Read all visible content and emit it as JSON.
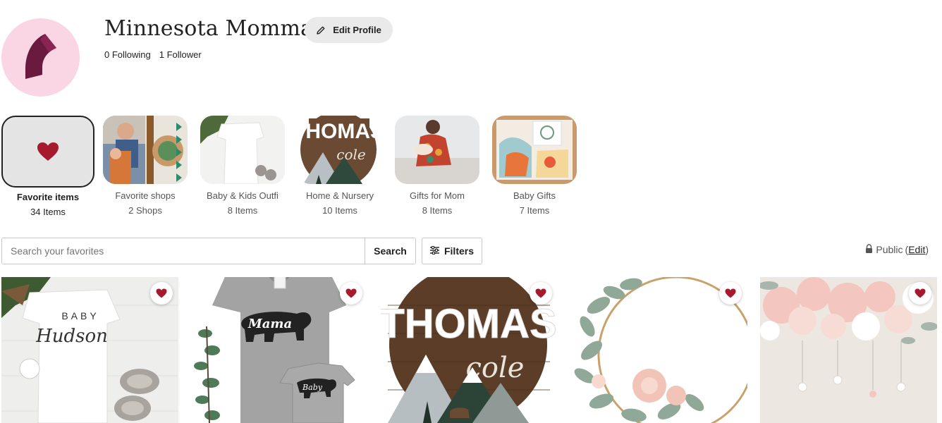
{
  "profile": {
    "name": "Minnesota Momma",
    "edit_label": "Edit Profile",
    "following": "0 Following",
    "followers": "1 Follower",
    "avatar_bg": "#fad5e3",
    "avatar_mark": "#6b1a3f"
  },
  "collections": [
    {
      "title": "Favorite items",
      "count": "34 Items",
      "active": true,
      "icon": "heart-icon"
    },
    {
      "title": "Favorite shops",
      "count": "2 Shops"
    },
    {
      "title": "Baby & Kids Outfi",
      "count": "8 Items"
    },
    {
      "title": "Home & Nursery",
      "count": "10 Items"
    },
    {
      "title": "Gifts for Mom",
      "count": "8 Items"
    },
    {
      "title": "Baby Gifts",
      "count": "7 Items"
    }
  ],
  "search": {
    "placeholder": "Search your favorites",
    "button_label": "Search",
    "filters_label": "Filters"
  },
  "visibility": {
    "status": "Public",
    "open_paren": "(",
    "edit_label": "Edit",
    "close_paren": ")"
  },
  "thumbnail_text": {
    "baby_onesie_top": "BABY",
    "baby_onesie_name": "Hudson",
    "nursery_sign_top": "THOMAS",
    "nursery_sign_bottom": "cole",
    "mama_shirt": "Mama",
    "baby_shirt": "Baby"
  },
  "items": [
    {
      "favorited": true
    },
    {
      "favorited": true
    },
    {
      "favorited": true
    },
    {
      "favorited": true
    },
    {
      "favorited": true
    }
  ],
  "colors": {
    "heart_red": "#a61a2e",
    "text_primary": "#222222",
    "text_secondary": "#555555",
    "border": "#c8c8c8"
  }
}
